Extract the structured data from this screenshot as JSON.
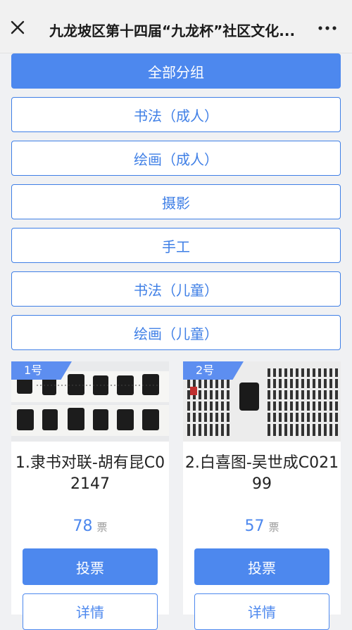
{
  "header": {
    "title": "九龙坡区第十四届“九龙杯”社区文化...",
    "close_icon": "close-icon",
    "more_icon": "more-horizontal-icon"
  },
  "groups": [
    {
      "label": "全部分组",
      "active": true
    },
    {
      "label": "书法（成人）",
      "active": false
    },
    {
      "label": "绘画（成人）",
      "active": false
    },
    {
      "label": "摄影",
      "active": false
    },
    {
      "label": "手工",
      "active": false
    },
    {
      "label": "书法（儿童）",
      "active": false
    },
    {
      "label": "绘画（儿童）",
      "active": false
    }
  ],
  "entries": [
    {
      "rank": "1号",
      "title": "1.隶书对联-胡有昆C02147",
      "votes": "78",
      "vote_unit": "票",
      "vote_label": "投票",
      "detail_label": "详情"
    },
    {
      "rank": "2号",
      "title": "2.白喜图-吴世成C02199",
      "votes": "57",
      "vote_unit": "票",
      "vote_label": "投票",
      "detail_label": "详情"
    }
  ],
  "colors": {
    "accent": "#4d88ee",
    "accent_border": "#3f7fe6"
  }
}
